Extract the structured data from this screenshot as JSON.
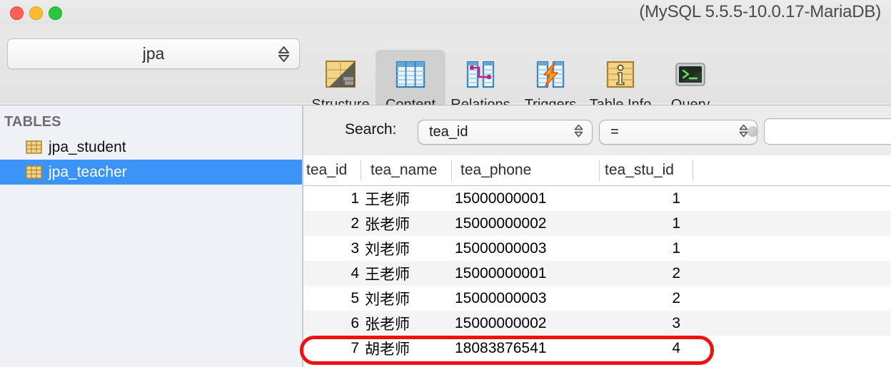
{
  "window": {
    "title": "(MySQL 5.5.5-10.0.17-MariaDB)",
    "traffic_lights": [
      "close-button",
      "minimize-button",
      "zoom-button"
    ],
    "colors": {
      "close": "#ff5f57",
      "minimize": "#febc2e",
      "zoom": "#28c840"
    }
  },
  "toolbar": {
    "database_select": {
      "value": "jpa",
      "label": "Select Database"
    },
    "tabs": [
      {
        "label": "Structure",
        "icon": "structure-icon",
        "selected": false
      },
      {
        "label": "Content",
        "icon": "content-table-icon",
        "selected": true
      },
      {
        "label": "Relations",
        "icon": "relations-icon",
        "selected": false
      },
      {
        "label": "Triggers",
        "icon": "triggers-icon",
        "selected": false
      },
      {
        "label": "Table Info",
        "icon": "table-info-icon",
        "selected": false
      },
      {
        "label": "Query",
        "icon": "query-terminal-icon",
        "selected": false
      }
    ]
  },
  "sidebar": {
    "header": "TABLES",
    "items": [
      {
        "label": "jpa_student",
        "selected": false
      },
      {
        "label": "jpa_teacher",
        "selected": true
      }
    ],
    "selected_color": "#3a93f5"
  },
  "search": {
    "label": "Search:",
    "field": "tea_id",
    "operator": "=",
    "value": "",
    "placeholder": ""
  },
  "table": {
    "columns": [
      "tea_id",
      "tea_name",
      "tea_phone",
      "tea_stu_id"
    ],
    "rows": [
      {
        "tea_id": "1",
        "tea_name": "王老师",
        "tea_phone": "15000000001",
        "tea_stu_id": "1"
      },
      {
        "tea_id": "2",
        "tea_name": "张老师",
        "tea_phone": "15000000002",
        "tea_stu_id": "1"
      },
      {
        "tea_id": "3",
        "tea_name": "刘老师",
        "tea_phone": "15000000003",
        "tea_stu_id": "1"
      },
      {
        "tea_id": "4",
        "tea_name": "王老师",
        "tea_phone": "15000000001",
        "tea_stu_id": "2"
      },
      {
        "tea_id": "5",
        "tea_name": "刘老师",
        "tea_phone": "15000000003",
        "tea_stu_id": "2"
      },
      {
        "tea_id": "6",
        "tea_name": "张老师",
        "tea_phone": "15000000002",
        "tea_stu_id": "3"
      },
      {
        "tea_id": "7",
        "tea_name": "胡老师",
        "tea_phone": "18083876541",
        "tea_stu_id": "4"
      }
    ]
  },
  "annotation": {
    "highlighted_row_index": 6,
    "color": "#ee1111"
  }
}
